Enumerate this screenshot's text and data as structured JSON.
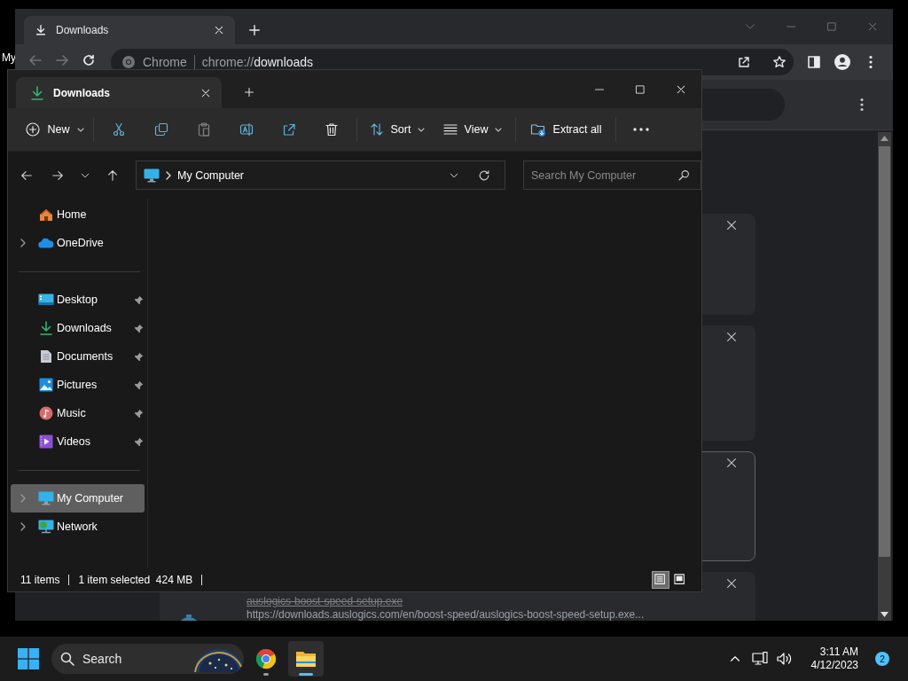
{
  "desktop": {
    "icon_label": "My"
  },
  "browser": {
    "tabs": [
      {
        "label": "Downloads",
        "selected": true
      }
    ],
    "omnibox": {
      "chip": "Chrome",
      "scheme": "chrome://",
      "path": "downloads"
    },
    "downloads": [
      {
        "focused": false
      },
      {
        "focused": false
      },
      {
        "focused": true
      },
      {
        "focused": false,
        "file_name": "auslogics-boost-speed-setup.exe",
        "url": "https://downloads.auslogics.com/en/boost-speed/auslogics-boost-speed-setup.exe..."
      }
    ]
  },
  "explorer": {
    "tabs": [
      {
        "label": "Downloads",
        "selected": true
      }
    ],
    "commands": [
      {
        "kind": "new",
        "label": "New",
        "disabled": false
      },
      {
        "kind": "cut",
        "disabled": false
      },
      {
        "kind": "copy",
        "disabled": false
      },
      {
        "kind": "paste",
        "disabled": true
      },
      {
        "kind": "rename",
        "disabled": false
      },
      {
        "kind": "share",
        "disabled": false
      },
      {
        "kind": "delete",
        "disabled": false
      },
      {
        "kind": "sort",
        "label": "Sort",
        "disabled": false
      },
      {
        "kind": "view",
        "label": "View",
        "disabled": false
      },
      {
        "kind": "extract",
        "label": "Extract all",
        "disabled": false
      },
      {
        "kind": "more",
        "disabled": false
      }
    ],
    "address": {
      "location": "My Computer"
    },
    "search": {
      "placeholder": "Search My Computer"
    },
    "sidebar": {
      "groups": [
        {
          "items": [
            {
              "kind": "home",
              "label": "Home",
              "expandable": false,
              "pinned": false,
              "selected": false
            },
            {
              "kind": "onedrive",
              "label": "OneDrive",
              "expandable": true,
              "pinned": false,
              "selected": false
            }
          ]
        },
        {
          "items": [
            {
              "kind": "desktop",
              "label": "Desktop",
              "expandable": false,
              "pinned": true,
              "selected": false
            },
            {
              "kind": "downloads",
              "label": "Downloads",
              "expandable": false,
              "pinned": true,
              "selected": false
            },
            {
              "kind": "documents",
              "label": "Documents",
              "expandable": false,
              "pinned": true,
              "selected": false
            },
            {
              "kind": "pictures",
              "label": "Pictures",
              "expandable": false,
              "pinned": true,
              "selected": false
            },
            {
              "kind": "music",
              "label": "Music",
              "expandable": false,
              "pinned": true,
              "selected": false
            },
            {
              "kind": "videos",
              "label": "Videos",
              "expandable": false,
              "pinned": true,
              "selected": false
            }
          ]
        },
        {
          "items": [
            {
              "kind": "computer",
              "label": "My Computer",
              "expandable": true,
              "pinned": false,
              "selected": true
            },
            {
              "kind": "network",
              "label": "Network",
              "expandable": true,
              "pinned": false,
              "selected": false
            }
          ]
        }
      ]
    },
    "status_bar": {
      "item_count": "11 items",
      "selection": "1 item selected",
      "size": "424 MB"
    },
    "view_buttons": [
      {
        "kind": "details",
        "selected": true
      },
      {
        "kind": "tiles",
        "selected": false
      }
    ]
  },
  "taskbar": {
    "search_label": "Search",
    "apps": [
      {
        "kind": "chrome",
        "active": false
      },
      {
        "kind": "explorer",
        "active": true
      }
    ],
    "clock": {
      "time": "3:11 AM",
      "date": "4/12/2023"
    },
    "notification_count": "2"
  }
}
